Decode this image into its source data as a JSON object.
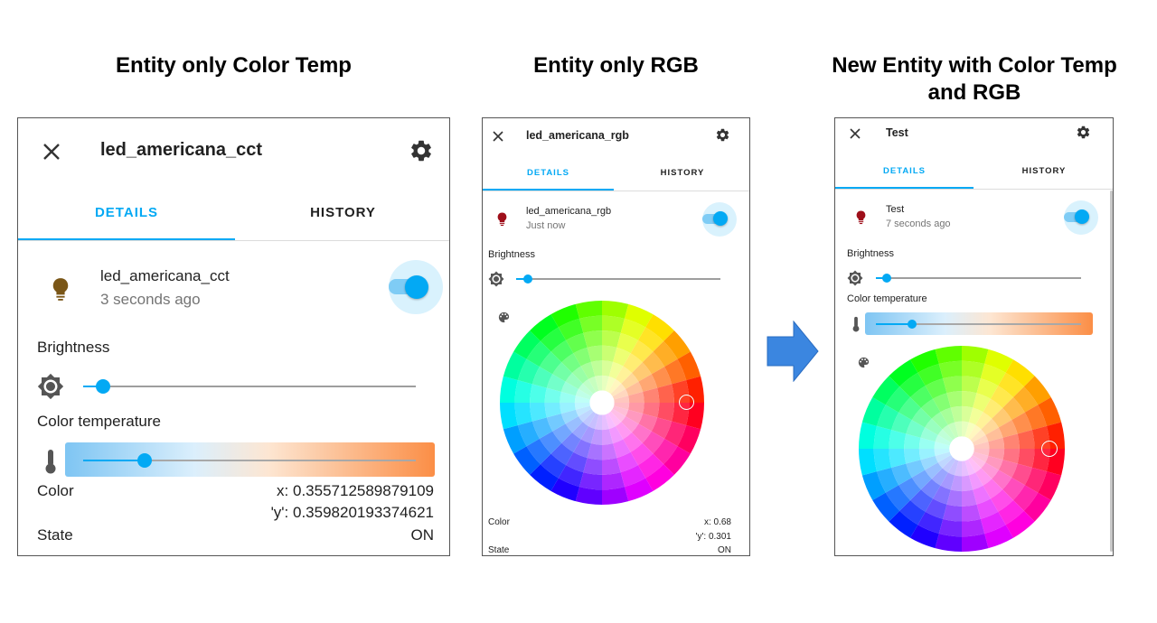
{
  "headings": {
    "left": "Entity only Color Temp",
    "middle": "Entity only RGB",
    "right_line1": "New Entity with Color Temp",
    "right_line2": "and RGB"
  },
  "panel_cct": {
    "title": "led_americana_cct",
    "tabs": [
      "DETAILS",
      "HISTORY"
    ],
    "entity_name": "led_americana_cct",
    "entity_time": "3 seconds ago",
    "bulb_color": "#7a5617",
    "brightness_label": "Brightness",
    "brightness_value": 0.06,
    "color_temp_label": "Color temperature",
    "color_temp_value": 0.18,
    "color_label": "Color",
    "color_x": "x: 0.355712589879109",
    "color_y": "'y': 0.359820193374621",
    "state_label": "State",
    "state_value": "ON",
    "toggle_on": true
  },
  "panel_rgb": {
    "title": "led_americana_rgb",
    "tabs": [
      "DETAILS",
      "HISTORY"
    ],
    "entity_name": "led_americana_rgb",
    "entity_time": "Just now",
    "bulb_color": "#9e0f1a",
    "brightness_label": "Brightness",
    "brightness_value": 0.06,
    "color_label": "Color",
    "color_x": "x: 0.68",
    "color_y": "'y': 0.301",
    "state_label": "State",
    "state_value": "ON",
    "toggle_on": true
  },
  "panel_new": {
    "title": "Test",
    "tabs": [
      "DETAILS",
      "HISTORY"
    ],
    "entity_name": "Test",
    "entity_time": "7 seconds ago",
    "bulb_color": "#9e0f1a",
    "brightness_label": "Brightness",
    "brightness_value": 0.06,
    "color_temp_label": "Color temperature",
    "color_temp_value": 0.18,
    "toggle_on": true
  },
  "colors": {
    "accent": "#03a9f4",
    "arrow": "#3b86e0"
  },
  "icons": [
    "close-icon",
    "gear-icon",
    "lightbulb-icon",
    "brightness-icon",
    "thermometer-icon",
    "palette-icon",
    "arrow-right-icon"
  ]
}
